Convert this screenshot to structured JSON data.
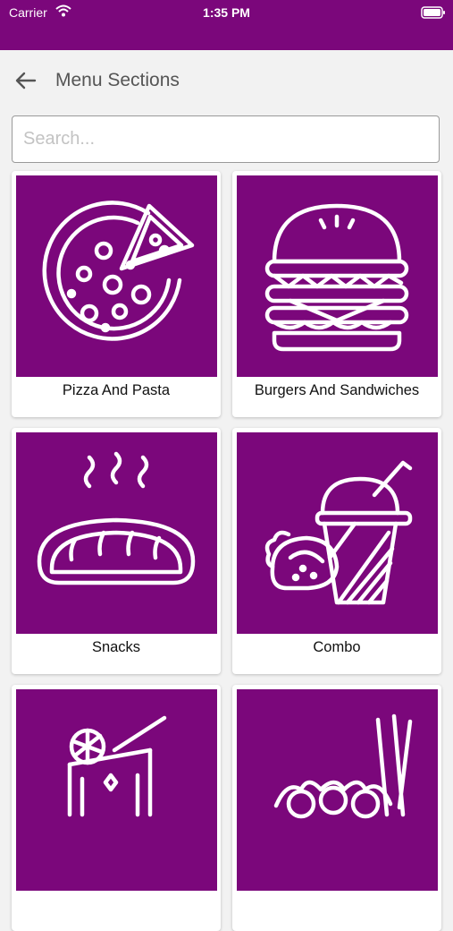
{
  "status_bar": {
    "carrier": "Carrier",
    "time": "1:35 PM"
  },
  "header": {
    "title": "Menu Sections"
  },
  "search": {
    "placeholder": "Search..."
  },
  "colors": {
    "brand": "#7b077b",
    "background": "#f2f2f2"
  },
  "sections": [
    {
      "label": "Pizza And Pasta",
      "icon": "pizza-icon"
    },
    {
      "label": "Burgers And Sandwiches",
      "icon": "burger-icon"
    },
    {
      "label": "Snacks",
      "icon": "bread-icon"
    },
    {
      "label": "Combo",
      "icon": "drink-taco-icon"
    },
    {
      "label": "",
      "icon": "juice-icon"
    },
    {
      "label": "",
      "icon": "skewer-icon"
    }
  ]
}
